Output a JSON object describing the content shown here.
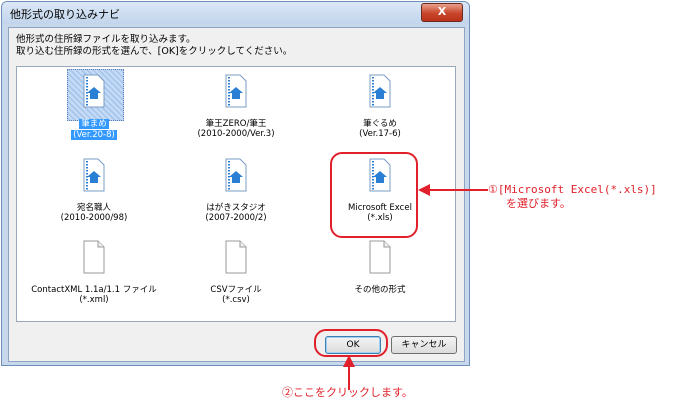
{
  "dialog": {
    "title": "他形式の取り込みナビ",
    "close_label": "X",
    "instruction_line1": "他形式の住所録ファイルを取り込みます。",
    "instruction_line2": "取り込む住所録の形式を選んで、[OK]をクリックしてください。"
  },
  "formats": [
    {
      "name": "筆まめ",
      "sub": "(Ver.20-8)",
      "icon": "blue-document-icon",
      "selected": true
    },
    {
      "name": "筆王ZERO/筆王",
      "sub": "(2010-2000/Ver.3)",
      "icon": "blue-document-icon"
    },
    {
      "name": "筆ぐるめ",
      "sub": "(Ver.17-6)",
      "icon": "blue-document-icon"
    },
    {
      "name": "宛名職人",
      "sub": "(2010-2000/98)",
      "icon": "blue-document-icon"
    },
    {
      "name": "はがきスタジオ",
      "sub": "(2007-2000/2)",
      "icon": "blue-document-icon"
    },
    {
      "name": "Microsoft Excel",
      "sub": "(*.xls)",
      "icon": "blue-document-icon"
    },
    {
      "name": "ContactXML 1.1a/1.1 ファイル",
      "sub": "(*.xml)",
      "icon": "blank-document-icon"
    },
    {
      "name": "CSVファイル",
      "sub": "(*.csv)",
      "icon": "blank-document-icon"
    },
    {
      "name": "その他の形式",
      "sub": "",
      "icon": "blank-document-icon"
    }
  ],
  "buttons": {
    "ok": "OK",
    "cancel": "キャンセル"
  },
  "annotations": {
    "step1_line1": "①[Microsoft Excel(*.xls)]",
    "step1_line2": "を選びます。",
    "step2": "②ここをクリックします。"
  },
  "colors": {
    "annotation": "#e0202a",
    "selection": "#3399ff",
    "icon_blue": "#2a7fd4"
  }
}
